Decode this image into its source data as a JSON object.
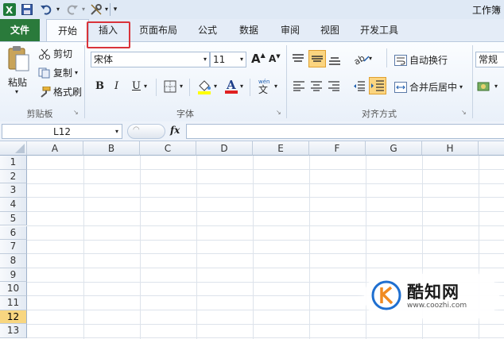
{
  "window": {
    "title": "工作簿"
  },
  "tabs": [
    {
      "label": "文件"
    },
    {
      "label": "开始"
    },
    {
      "label": "插入"
    },
    {
      "label": "页面布局"
    },
    {
      "label": "公式"
    },
    {
      "label": "数据"
    },
    {
      "label": "审阅"
    },
    {
      "label": "视图"
    },
    {
      "label": "开发工具"
    }
  ],
  "ribbon": {
    "clipboard": {
      "paste": "粘贴",
      "cut": "剪切",
      "copy": "复制",
      "format_painter": "格式刷",
      "group_label": "剪贴板"
    },
    "font": {
      "font_name": "宋体",
      "font_size": "11",
      "bold": "B",
      "italic": "I",
      "underline": "U",
      "grow": "A",
      "shrink": "A",
      "group_label": "字体"
    },
    "alignment": {
      "wrap_text": "自动换行",
      "merge_center": "合并后居中",
      "group_label": "对齐方式"
    },
    "number": {
      "format": "常规"
    }
  },
  "formula_bar": {
    "name_box": "L12",
    "fx": "fx",
    "content": ""
  },
  "sheet": {
    "columns": [
      "A",
      "B",
      "C",
      "D",
      "E",
      "F",
      "G",
      "H"
    ],
    "rows": [
      "1",
      "2",
      "3",
      "4",
      "5",
      "6",
      "7",
      "8",
      "9",
      "10",
      "11",
      "12",
      "13"
    ],
    "selected_row": "12"
  },
  "watermark": {
    "brand": "酷知网",
    "url": "www.coozhi.com"
  },
  "colors": {
    "file_tab": "#2a7a3b",
    "highlight": "#d9333a",
    "selected_row": "#f8d680",
    "fill_color": "#ffff00",
    "font_color": "#e02020"
  }
}
